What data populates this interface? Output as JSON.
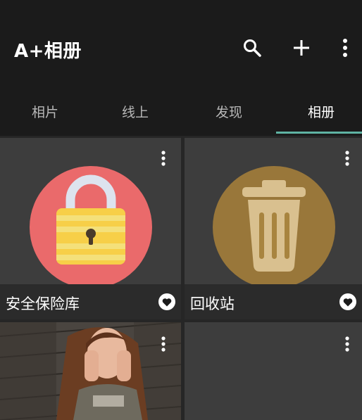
{
  "app": {
    "title": "A+相册"
  },
  "actions": {
    "search_icon": "search-icon",
    "add_icon": "plus-icon",
    "more_icon": "more-vert-icon"
  },
  "tabs": [
    {
      "label": "相片",
      "active": false
    },
    {
      "label": "线上",
      "active": false
    },
    {
      "label": "发现",
      "active": false
    },
    {
      "label": "相册",
      "active": true
    }
  ],
  "albums": [
    {
      "name": "安全保险库",
      "icon": "lock-icon",
      "circle_color": "#ea6a6b",
      "favorite": true
    },
    {
      "name": "回收站",
      "icon": "trash-icon",
      "circle_color": "#99773a",
      "favorite": true
    },
    {
      "name": "",
      "icon": "photo-thumbnail",
      "favorite": false
    },
    {
      "name": "",
      "icon": "",
      "favorite": false
    }
  ],
  "colors": {
    "background": "#1b1b1b",
    "card": "#3d3d3d",
    "accent": "#5fb3a3"
  }
}
